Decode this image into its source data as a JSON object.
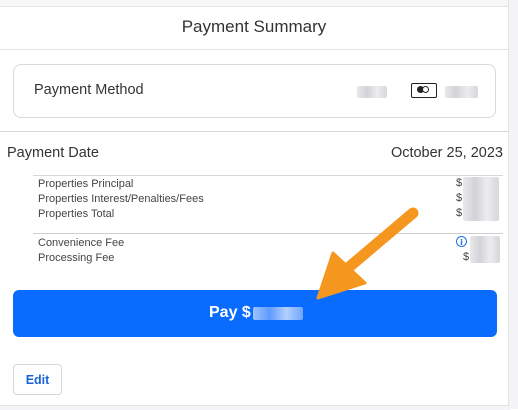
{
  "header": {
    "title": "Payment Summary"
  },
  "payment_method": {
    "label": "Payment Method",
    "card_icon": "credit-card-icon",
    "card_detail_redacted": true
  },
  "payment_date": {
    "label": "Payment Date",
    "value": "October 25, 2023"
  },
  "line_items": {
    "group1": [
      {
        "label": "Properties Principal",
        "amount_prefix": "$"
      },
      {
        "label": "Properties Interest/Penalties/Fees",
        "amount_prefix": "$"
      },
      {
        "label": "Properties Total",
        "amount_prefix": "$"
      }
    ],
    "group2": [
      {
        "label": "Convenience Fee",
        "info_icon": "info-icon"
      },
      {
        "label": "Processing Fee",
        "amount_prefix": "$"
      }
    ]
  },
  "pay_button": {
    "label": "Pay $",
    "color": "#0a6bff"
  },
  "edit_button": {
    "label": "Edit"
  },
  "annotation": {
    "arrow_color": "#f5961f",
    "arrow_icon": "annotation-arrow"
  }
}
